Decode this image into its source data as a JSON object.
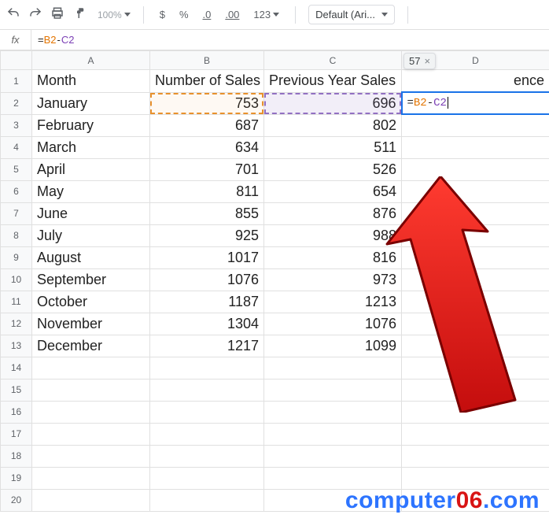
{
  "toolbar": {
    "zoom_label": "100%",
    "currency_label": "$",
    "percent_label": "%",
    "dec_dec_label": ".0",
    "inc_dec_label": ".00",
    "format_123_label": "123",
    "font_label": "Default (Ari..."
  },
  "formula_bar": {
    "fx_label": "fx",
    "equals": "=",
    "ref_b2": "B2",
    "operator": "-",
    "ref_c2": "C2"
  },
  "columns": [
    "A",
    "B",
    "C",
    "D"
  ],
  "headers": {
    "A": "Month",
    "B": "Number of Sales",
    "C": "Previous Year Sales",
    "D_visible": "ence"
  },
  "rows": [
    {
      "n": 1
    },
    {
      "n": 2,
      "month": "January",
      "sales": 753,
      "prev": 696
    },
    {
      "n": 3,
      "month": "February",
      "sales": 687,
      "prev": 802
    },
    {
      "n": 4,
      "month": "March",
      "sales": 634,
      "prev": 511
    },
    {
      "n": 5,
      "month": "April",
      "sales": 701,
      "prev": 526
    },
    {
      "n": 6,
      "month": "May",
      "sales": 811,
      "prev": 654
    },
    {
      "n": 7,
      "month": "June",
      "sales": 855,
      "prev": 876
    },
    {
      "n": 8,
      "month": "July",
      "sales": 925,
      "prev": 988
    },
    {
      "n": 9,
      "month": "August",
      "sales": 1017,
      "prev": 816
    },
    {
      "n": 10,
      "month": "September",
      "sales": 1076,
      "prev": 973
    },
    {
      "n": 11,
      "month": "October",
      "sales": 1187,
      "prev": 1213
    },
    {
      "n": 12,
      "month": "November",
      "sales": 1304,
      "prev": 1076
    },
    {
      "n": 13,
      "month": "December",
      "sales": 1217,
      "prev": 1099
    }
  ],
  "active_cell": {
    "address": "D2",
    "equals": "=",
    "ref_b2": "B2",
    "operator": "-",
    "ref_c2": "C2",
    "tooltip_value": "57",
    "tooltip_close": "×"
  },
  "blank_rows": [
    14,
    15,
    16,
    17,
    18,
    19,
    20
  ],
  "watermark": {
    "prefix": "computer",
    "highlight": "06",
    "suffix": ".com"
  }
}
